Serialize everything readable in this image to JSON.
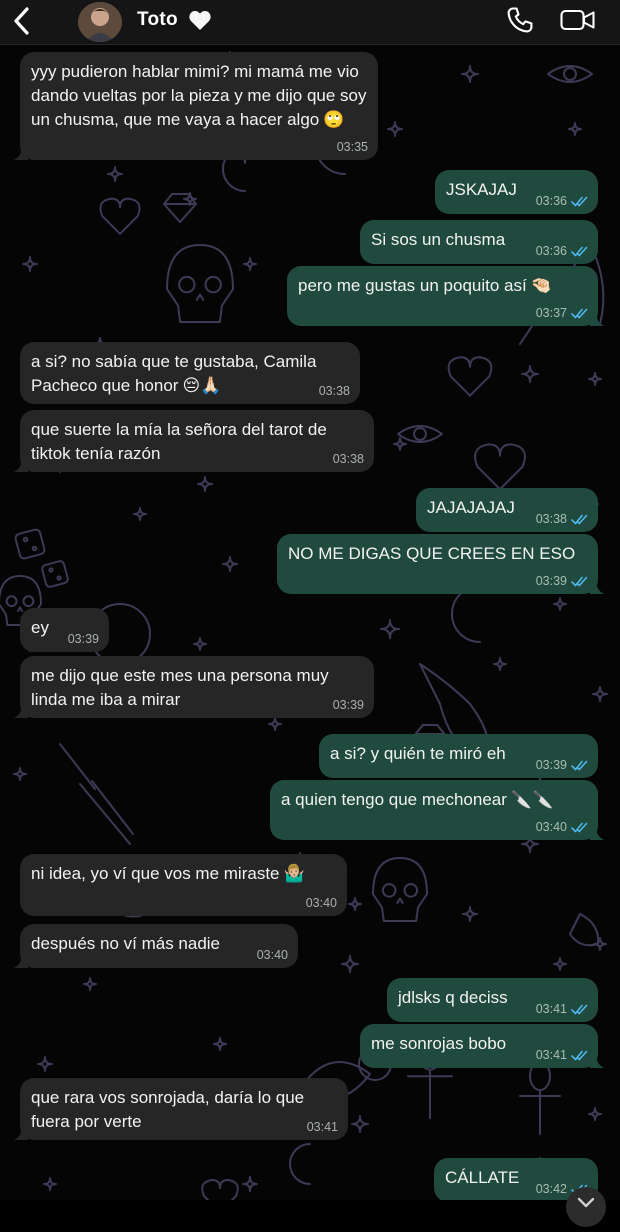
{
  "header": {
    "contact_name": "Toto",
    "icons": {
      "back": "chevron-left-icon",
      "heart": "white-heart-icon",
      "call": "phone-icon",
      "video": "video-camera-icon"
    }
  },
  "messages": [
    {
      "dir": "in",
      "text": "yyy pudieron hablar mimi? mi mamá me vio dando vueltas por la pieza y me dijo que soy un chusma, que me vaya a hacer algo",
      "emoji": "🙄",
      "time": "03:35"
    },
    {
      "dir": "out",
      "text": "JSKAJAJ",
      "time": "03:36",
      "read": true
    },
    {
      "dir": "out",
      "text": "Si sos un chusma",
      "time": "03:36",
      "read": true
    },
    {
      "dir": "out",
      "text": "pero me gustas un poquito así",
      "emoji": "🤏🏻",
      "time": "03:37",
      "read": true
    },
    {
      "dir": "in",
      "text": "a si? no sabía que te gustaba, Camila Pacheco que honor",
      "emoji": "😔🙏🏻",
      "time": "03:38"
    },
    {
      "dir": "in",
      "text": "que suerte la mía la señora del tarot de tiktok tenía razón",
      "time": "03:38"
    },
    {
      "dir": "out",
      "text": "JAJAJAJAJ",
      "time": "03:38",
      "read": true
    },
    {
      "dir": "out",
      "text": "NO ME DIGAS QUE CREES EN ESO",
      "time": "03:39",
      "read": true
    },
    {
      "dir": "in",
      "text": "ey",
      "time": "03:39"
    },
    {
      "dir": "in",
      "text": "me dijo que este mes una persona muy linda me iba a mirar",
      "time": "03:39"
    },
    {
      "dir": "out",
      "text": "a si? y quién te miró eh",
      "time": "03:39",
      "read": true
    },
    {
      "dir": "out",
      "text": "a quien tengo que mechonear",
      "emoji": "🔪🔪",
      "time": "03:40",
      "read": true
    },
    {
      "dir": "in",
      "text": "ni idea, yo ví que vos me miraste",
      "emoji": "🤷🏼‍♂️",
      "time": "03:40"
    },
    {
      "dir": "in",
      "text": "después no ví más nadie",
      "time": "03:40"
    },
    {
      "dir": "out",
      "text": "jdlsks q deciss",
      "time": "03:41",
      "read": true
    },
    {
      "dir": "out",
      "text": "me sonrojas bobo",
      "time": "03:41",
      "read": true
    },
    {
      "dir": "in",
      "text": "que rara vos sonrojada, daría lo que fuera por verte",
      "time": "03:41"
    },
    {
      "dir": "out",
      "text": "CÁLLATE",
      "time": "03:42",
      "read": true
    }
  ],
  "colors": {
    "incoming_bubble": "#262626",
    "outgoing_bubble": "#1f4a3d",
    "read_check": "#4fb6ec",
    "wallpaper_doodle": "#3d3a55"
  }
}
